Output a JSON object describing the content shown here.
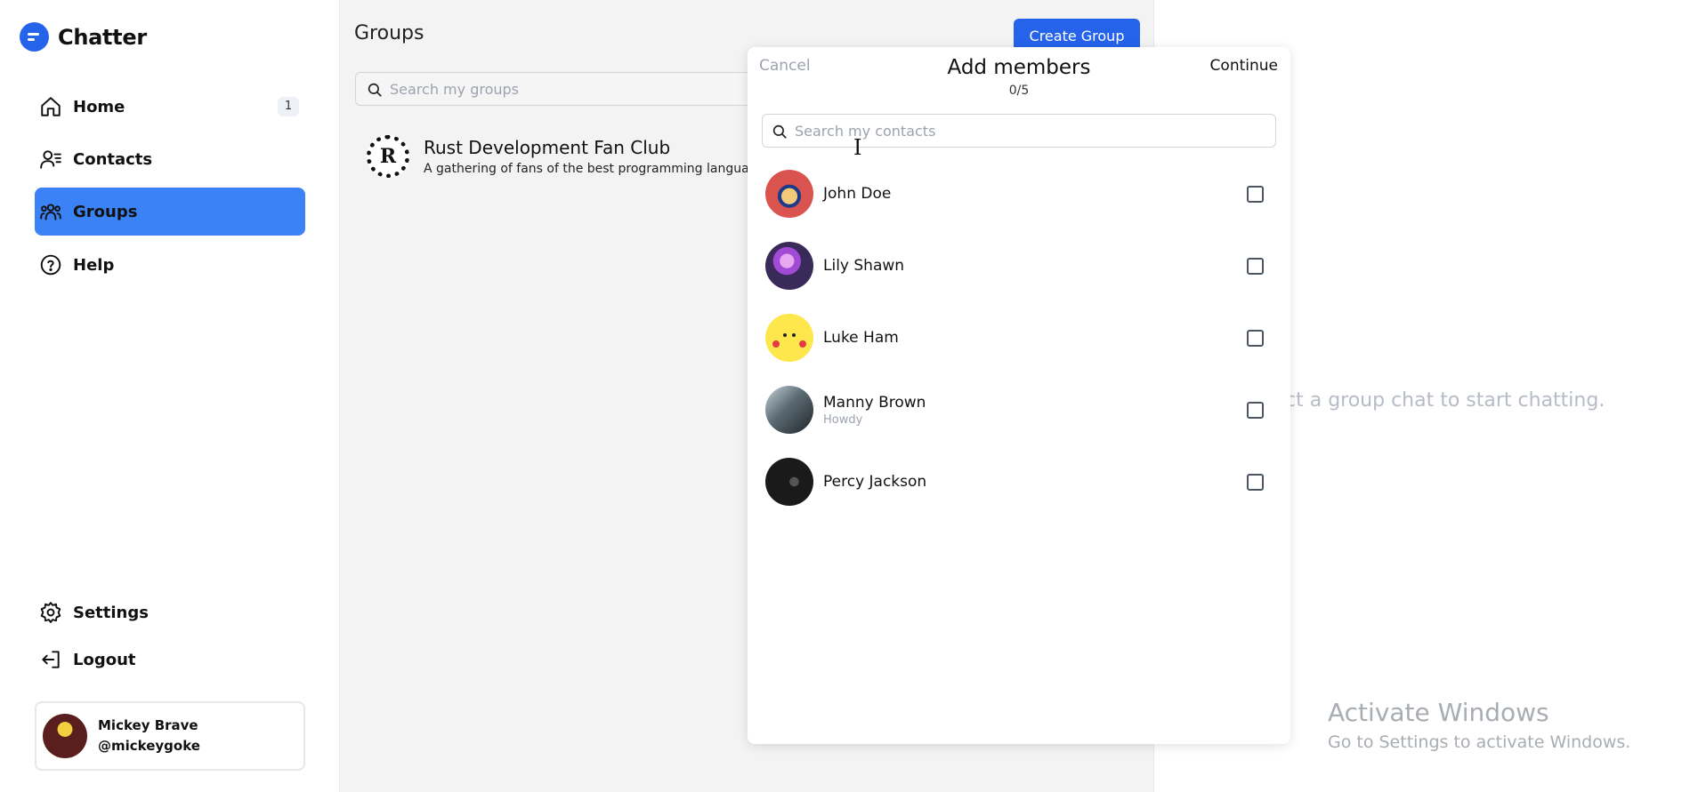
{
  "app": {
    "name": "Chatter"
  },
  "sidebar": {
    "items": [
      {
        "label": "Home",
        "icon": "home-icon",
        "badge": "1"
      },
      {
        "label": "Contacts",
        "icon": "contacts-icon"
      },
      {
        "label": "Groups",
        "icon": "groups-icon",
        "active": true
      },
      {
        "label": "Help",
        "icon": "help-icon"
      }
    ],
    "bottom_items": [
      {
        "label": "Settings",
        "icon": "gear-icon"
      },
      {
        "label": "Logout",
        "icon": "logout-icon"
      }
    ],
    "profile": {
      "name": "Mickey Brave",
      "handle": "@mickeygoke"
    }
  },
  "groups_panel": {
    "title": "Groups",
    "create_label": "Create Group",
    "search_placeholder": "Search my groups",
    "groups": [
      {
        "name": "Rust Development Fan Club",
        "description": "A gathering of fans of the best programming languag"
      }
    ]
  },
  "right_panel": {
    "message": "ct a group chat to start chatting."
  },
  "modal": {
    "cancel_label": "Cancel",
    "title": "Add members",
    "count": "0/5",
    "continue_label": "Continue",
    "search_placeholder": "Search my contacts",
    "contacts": [
      {
        "name": "John Doe",
        "status": "",
        "checked": false
      },
      {
        "name": "Lily Shawn",
        "status": "",
        "checked": false
      },
      {
        "name": "Luke Ham",
        "status": "",
        "checked": false
      },
      {
        "name": "Manny Brown",
        "status": "Howdy",
        "checked": false
      },
      {
        "name": "Percy Jackson",
        "status": "",
        "checked": false
      }
    ]
  },
  "watermark": {
    "title": "Activate Windows",
    "subtitle": "Go to Settings to activate Windows."
  },
  "colors": {
    "accent": "#2563eb",
    "active_nav": "#3b82f6"
  }
}
